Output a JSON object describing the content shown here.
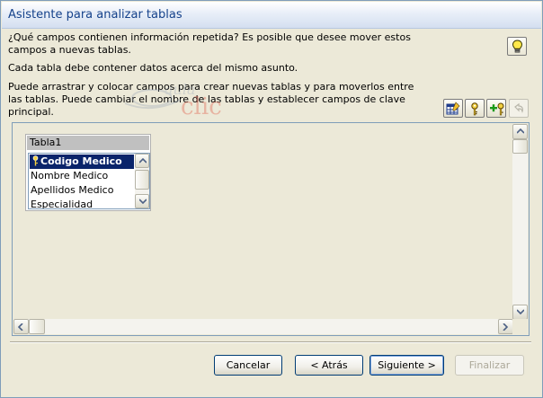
{
  "window": {
    "title": "Asistente para analizar tablas"
  },
  "instructions": {
    "line1": "¿Qué campos contienen información repetida? Es posible que desee mover estos campos a nuevas tablas.",
    "line2": "Cada tabla debe contener datos acerca del mismo asunto.",
    "line3": "Puede arrastrar y colocar campos para crear nuevas tablas y para moverlos entre las tablas. Puede cambiar el nombre de las tablas y establecer campos de clave principal."
  },
  "watermark": {
    "text1": "aula",
    "text2": "clic"
  },
  "table": {
    "name": "Tabla1",
    "fields": [
      {
        "label": "Codigo Medico",
        "primary_key": true
      },
      {
        "label": "Nombre Medico",
        "primary_key": false
      },
      {
        "label": "Apellidos Medico",
        "primary_key": false
      },
      {
        "label": "Especialidad",
        "primary_key": false
      }
    ]
  },
  "toolbar": {
    "icons": [
      "rename-table-icon",
      "set-primary-key-icon",
      "add-generated-key-icon",
      "undo-icon"
    ]
  },
  "buttons": {
    "cancel": "Cancelar",
    "back": "< Atrás",
    "next": "Siguiente >",
    "finish": "Finalizar"
  },
  "colors": {
    "title_text": "#15428b",
    "dialog_bg": "#ece9d8",
    "selection": "#0a246a"
  }
}
